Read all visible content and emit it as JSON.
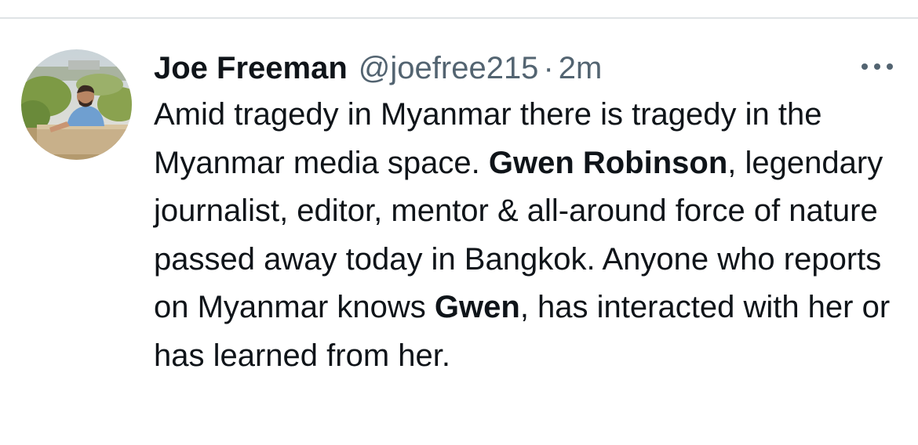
{
  "tweet": {
    "author_name": "Joe Freeman",
    "handle": "@joefree215",
    "separator": "·",
    "time": "2m",
    "more_icon": "more-horizontal-icon",
    "text": {
      "seg1": "Amid tragedy in Myanmar there is tragedy in the Myanmar media space. ",
      "bold1": "Gwen Robinson",
      "seg2": ", legendary journalist, editor, mentor & all-around force of nature passed away today in Bangkok. Anyone who reports on Myanmar knows ",
      "bold2": "Gwen",
      "seg3": ", has interacted with her or has learned from her."
    }
  },
  "colors": {
    "text_primary": "#0f1419",
    "text_secondary": "#536471",
    "divider": "#dfe3e6",
    "background": "#ffffff"
  }
}
